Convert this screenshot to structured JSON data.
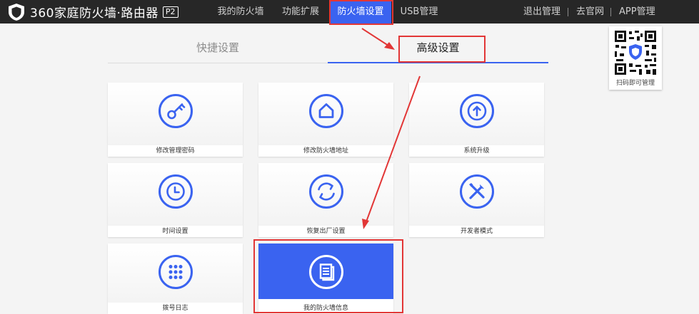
{
  "brand": {
    "name": "360家庭防火墙·路由器",
    "badge": "P2"
  },
  "nav": {
    "items": [
      {
        "label": "我的防火墙",
        "active": false
      },
      {
        "label": "功能扩展",
        "active": false
      },
      {
        "label": "防火墙设置",
        "active": true
      },
      {
        "label": "USB管理",
        "active": false
      }
    ]
  },
  "header_links": {
    "logout": "退出管理",
    "official_site": "去官网",
    "app": "APP管理"
  },
  "qr_panel": {
    "caption": "扫码即可管理"
  },
  "tabs": {
    "quick": "快捷设置",
    "advanced": "高级设置",
    "active": "advanced"
  },
  "cards": [
    {
      "label": "修改管理密码",
      "icon": "key-icon",
      "active": false
    },
    {
      "label": "修改防火墙地址",
      "icon": "home-icon",
      "active": false
    },
    {
      "label": "系统升级",
      "icon": "upgrade-arrow-icon",
      "active": false
    },
    {
      "label": "时间设置",
      "icon": "clock-icon",
      "active": false
    },
    {
      "label": "恢复出厂设置",
      "icon": "refresh-icon",
      "active": false
    },
    {
      "label": "开发者模式",
      "icon": "tools-icon",
      "active": false
    },
    {
      "label": "拨号日志",
      "icon": "dialpad-icon",
      "active": false
    },
    {
      "label": "我的防火墙信息",
      "icon": "document-icon",
      "active": true
    }
  ],
  "colors": {
    "accent": "#3a63f0",
    "topbar": "#272727",
    "annotation": "#e23636"
  }
}
